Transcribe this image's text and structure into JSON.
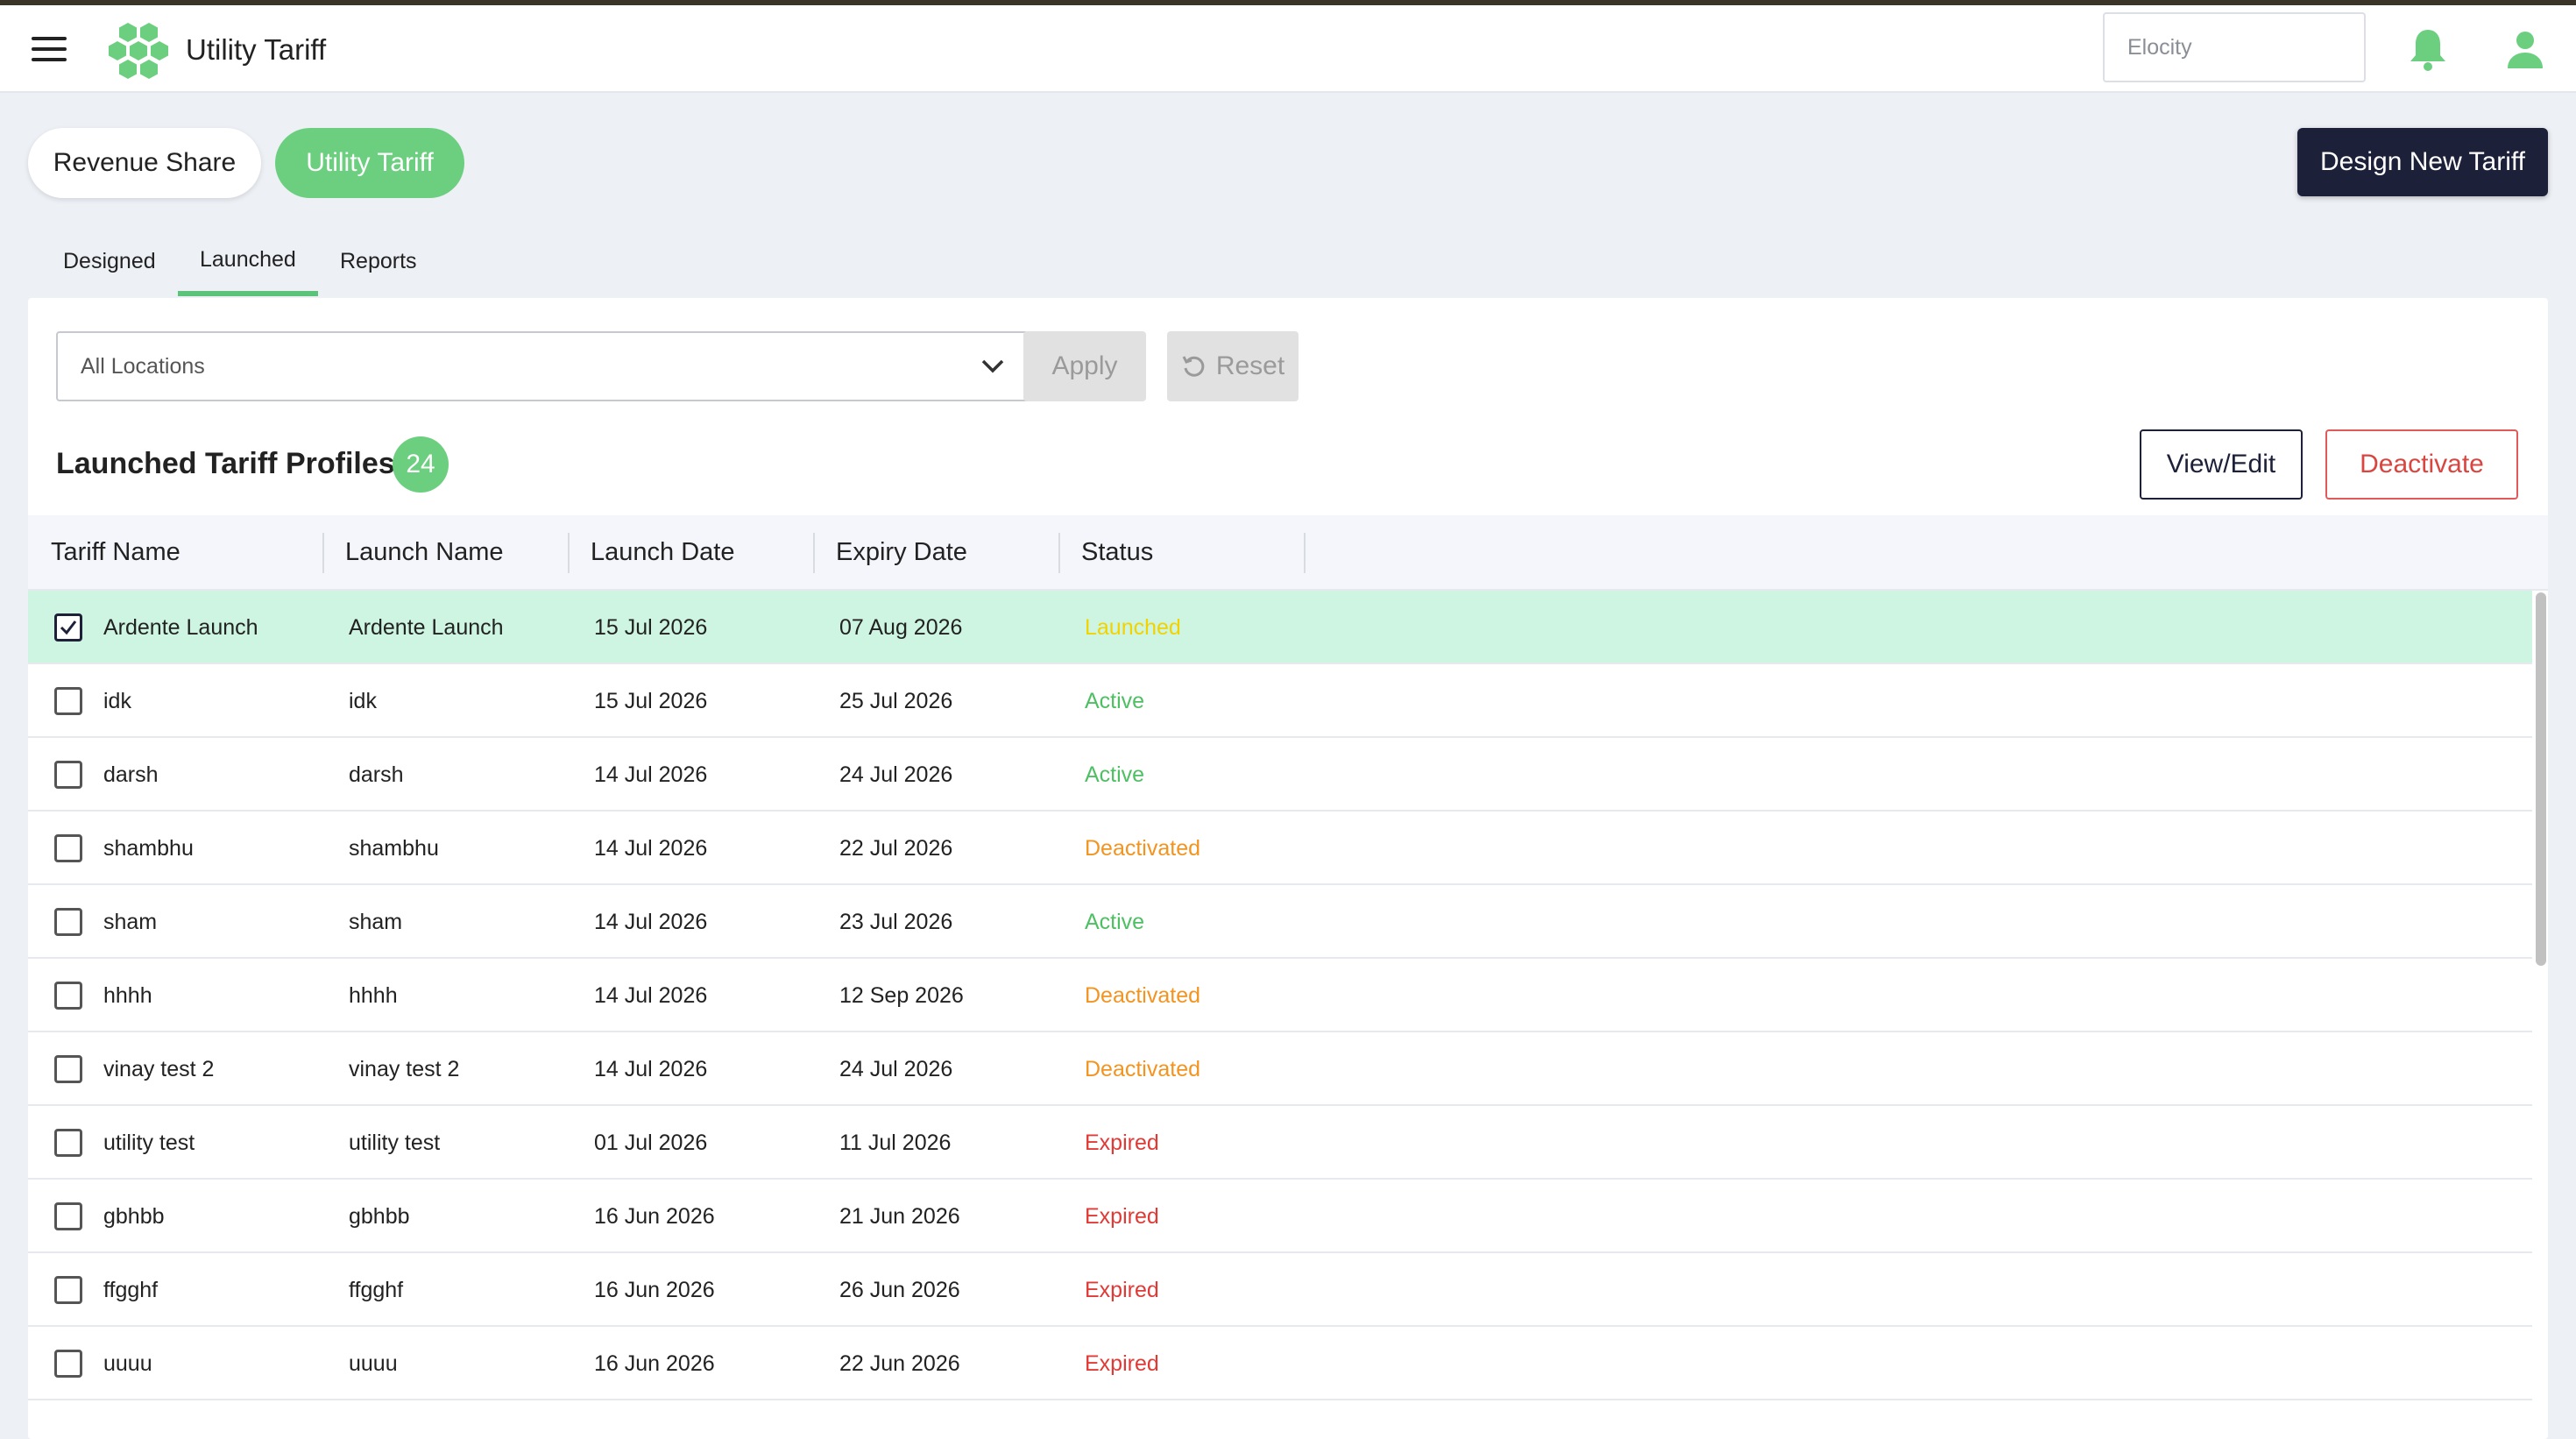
{
  "header": {
    "app_title": "Utility Tariff",
    "search_placeholder": "Elocity",
    "icons": [
      "menu-icon",
      "logo-icon",
      "bell-icon",
      "user-icon"
    ],
    "accent_color": "#6ccf7f"
  },
  "toggle": {
    "revenue_share": "Revenue Share",
    "utility_tariff": "Utility Tariff"
  },
  "design_button": "Design New Tariff",
  "tabs": [
    "Designed",
    "Launched",
    "Reports"
  ],
  "active_tab": "Launched",
  "filters": {
    "location": "All Locations",
    "apply": "Apply",
    "reset": "Reset"
  },
  "profiles": {
    "title": "Launched Tariff Profiles",
    "count": "24",
    "view_edit": "View/Edit",
    "deactivate": "Deactivate"
  },
  "table": {
    "columns": [
      "Tariff Name",
      "Launch Name",
      "Launch Date",
      "Expiry Date",
      "Status"
    ],
    "rows": [
      {
        "tariff": "Ardente Launch",
        "launch": "Ardente Launch",
        "launch_date": "15 Jul 2026",
        "expiry_date": "07 Aug 2026",
        "status": "Launched",
        "checked": true
      },
      {
        "tariff": "idk",
        "launch": "idk",
        "launch_date": "15 Jul 2026",
        "expiry_date": "25 Jul 2026",
        "status": "Active",
        "checked": false
      },
      {
        "tariff": "darsh",
        "launch": "darsh",
        "launch_date": "14 Jul 2026",
        "expiry_date": "24 Jul 2026",
        "status": "Active",
        "checked": false
      },
      {
        "tariff": "shambhu",
        "launch": "shambhu",
        "launch_date": "14 Jul 2026",
        "expiry_date": "22 Jul 2026",
        "status": "Deactivated",
        "checked": false
      },
      {
        "tariff": "sham",
        "launch": "sham",
        "launch_date": "14 Jul 2026",
        "expiry_date": "23 Jul 2026",
        "status": "Active",
        "checked": false
      },
      {
        "tariff": "hhhh",
        "launch": "hhhh",
        "launch_date": "14 Jul 2026",
        "expiry_date": "12 Sep 2026",
        "status": "Deactivated",
        "checked": false
      },
      {
        "tariff": "vinay test 2",
        "launch": "vinay test 2",
        "launch_date": "14 Jul 2026",
        "expiry_date": "24 Jul 2026",
        "status": "Deactivated",
        "checked": false
      },
      {
        "tariff": "utility test",
        "launch": "utility test",
        "launch_date": "01 Jul 2026",
        "expiry_date": "11 Jul 2026",
        "status": "Expired",
        "checked": false
      },
      {
        "tariff": "gbhbb",
        "launch": "gbhbb",
        "launch_date": "16 Jun 2026",
        "expiry_date": "21 Jun 2026",
        "status": "Expired",
        "checked": false
      },
      {
        "tariff": "ffgghf",
        "launch": "ffgghf",
        "launch_date": "16 Jun 2026",
        "expiry_date": "26 Jun 2026",
        "status": "Expired",
        "checked": false
      },
      {
        "tariff": "uuuu",
        "launch": "uuuu",
        "launch_date": "16 Jun 2026",
        "expiry_date": "22 Jun 2026",
        "status": "Expired",
        "checked": false
      }
    ]
  },
  "status_colors": {
    "Launched": "#f2d300",
    "Active": "#4fbf63",
    "Deactivated": "#f2941f",
    "Expired": "#e03a36"
  }
}
